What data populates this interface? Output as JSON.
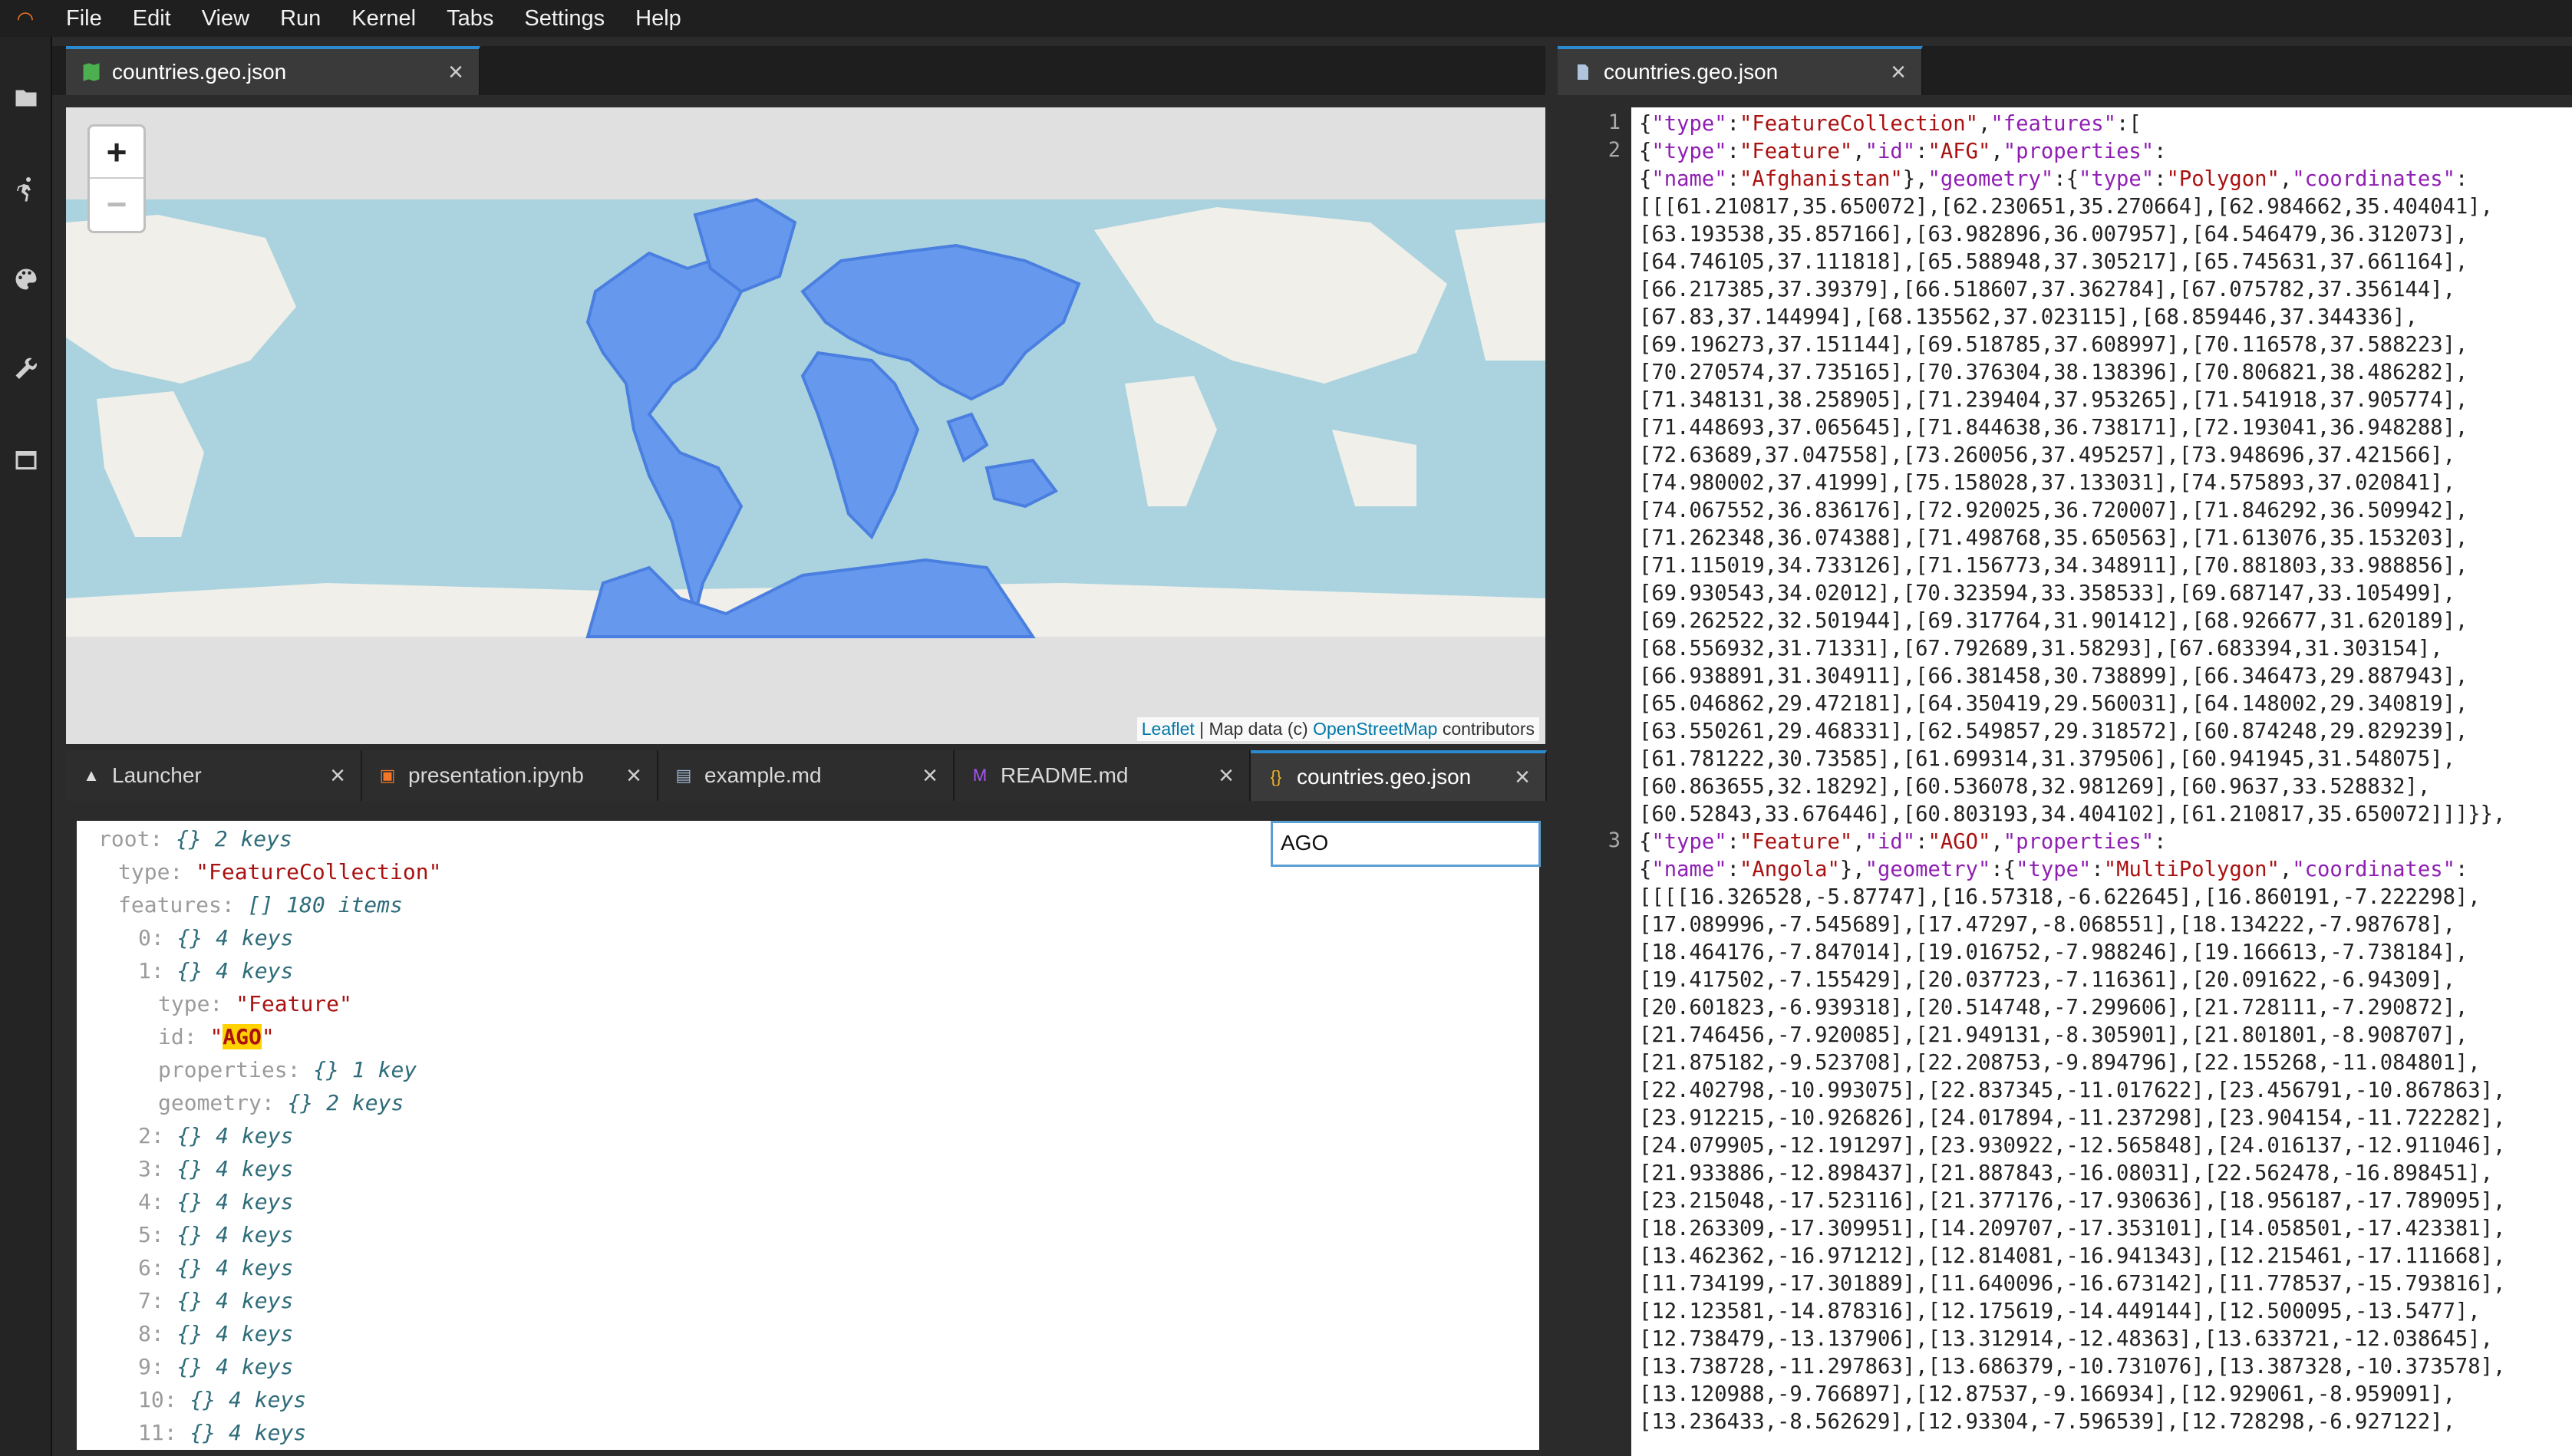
{
  "menubar": {
    "items": [
      "File",
      "Edit",
      "View",
      "Run",
      "Kernel",
      "Tabs",
      "Settings",
      "Help"
    ]
  },
  "sidebar": {
    "icons": [
      "folder-icon",
      "running-icon",
      "palette-icon",
      "wrench-icon",
      "tabs-icon"
    ]
  },
  "left_panel": {
    "tab": {
      "label": "countries.geo.json",
      "icon": "map-icon"
    }
  },
  "map": {
    "zoom_in": "+",
    "zoom_out": "−",
    "attribution": {
      "leaflet": "Leaflet",
      "sep": " | Map data (c) ",
      "osm": "OpenStreetMap",
      "tail": " contributors"
    }
  },
  "bottom_tabs": [
    {
      "label": "Launcher",
      "icon": "launcher-icon"
    },
    {
      "label": "presentation.ipynb",
      "icon": "notebook-icon"
    },
    {
      "label": "example.md",
      "icon": "file-icon"
    },
    {
      "label": "README.md",
      "icon": "markdown-icon"
    },
    {
      "label": "countries.geo.json",
      "icon": "json-icon",
      "active": true
    }
  ],
  "json_tree": {
    "search_value": "AGO",
    "rows": [
      {
        "indent": 0,
        "key": "root:",
        "val": "{}",
        "meta": "2 keys"
      },
      {
        "indent": 1,
        "key": "type:",
        "str": "\"FeatureCollection\""
      },
      {
        "indent": 1,
        "key": "features:",
        "val": "[]",
        "meta": "180 items"
      },
      {
        "indent": 2,
        "key": "0:",
        "val": "{}",
        "meta": "4 keys"
      },
      {
        "indent": 2,
        "key": "1:",
        "val": "{}",
        "meta": "4 keys"
      },
      {
        "indent": 3,
        "key": "type:",
        "str": "\"Feature\""
      },
      {
        "indent": 3,
        "key": "id:",
        "str_hl": [
          "\"",
          "AGO",
          "\""
        ]
      },
      {
        "indent": 3,
        "key": "properties:",
        "val": "{}",
        "meta": "1 key"
      },
      {
        "indent": 3,
        "key": "geometry:",
        "val": "{}",
        "meta": "2 keys"
      },
      {
        "indent": 2,
        "key": "2:",
        "val": "{}",
        "meta": "4 keys"
      },
      {
        "indent": 2,
        "key": "3:",
        "val": "{}",
        "meta": "4 keys"
      },
      {
        "indent": 2,
        "key": "4:",
        "val": "{}",
        "meta": "4 keys"
      },
      {
        "indent": 2,
        "key": "5:",
        "val": "{}",
        "meta": "4 keys"
      },
      {
        "indent": 2,
        "key": "6:",
        "val": "{}",
        "meta": "4 keys"
      },
      {
        "indent": 2,
        "key": "7:",
        "val": "{}",
        "meta": "4 keys"
      },
      {
        "indent": 2,
        "key": "8:",
        "val": "{}",
        "meta": "4 keys"
      },
      {
        "indent": 2,
        "key": "9:",
        "val": "{}",
        "meta": "4 keys"
      },
      {
        "indent": 2,
        "key": "10:",
        "val": "{}",
        "meta": "4 keys"
      },
      {
        "indent": 2,
        "key": "11:",
        "val": "{}",
        "meta": "4 keys"
      }
    ]
  },
  "right_panel": {
    "tab": {
      "label": "countries.geo.json",
      "icon": "file-icon"
    },
    "line_numbers": [
      {
        "n": "1",
        "line_index": 0
      },
      {
        "n": "2",
        "line_index": 1
      },
      {
        "n": "3",
        "line_index": 26
      }
    ],
    "code_lines": [
      "{\"type\":\"FeatureCollection\",\"features\":[",
      "{\"type\":\"Feature\",\"id\":\"AFG\",\"properties\":",
      "{\"name\":\"Afghanistan\"},\"geometry\":{\"type\":\"Polygon\",\"coordinates\":",
      "[[[61.210817,35.650072],[62.230651,35.270664],[62.984662,35.404041],",
      "[63.193538,35.857166],[63.982896,36.007957],[64.546479,36.312073],",
      "[64.746105,37.111818],[65.588948,37.305217],[65.745631,37.661164],",
      "[66.217385,37.39379],[66.518607,37.362784],[67.075782,37.356144],",
      "[67.83,37.144994],[68.135562,37.023115],[68.859446,37.344336],",
      "[69.196273,37.151144],[69.518785,37.608997],[70.116578,37.588223],",
      "[70.270574,37.735165],[70.376304,38.138396],[70.806821,38.486282],",
      "[71.348131,38.258905],[71.239404,37.953265],[71.541918,37.905774],",
      "[71.448693,37.065645],[71.844638,36.738171],[72.193041,36.948288],",
      "[72.63689,37.047558],[73.260056,37.495257],[73.948696,37.421566],",
      "[74.980002,37.41999],[75.158028,37.133031],[74.575893,37.020841],",
      "[74.067552,36.836176],[72.920025,36.720007],[71.846292,36.509942],",
      "[71.262348,36.074388],[71.498768,35.650563],[71.613076,35.153203],",
      "[71.115019,34.733126],[71.156773,34.348911],[70.881803,33.988856],",
      "[69.930543,34.02012],[70.323594,33.358533],[69.687147,33.105499],",
      "[69.262522,32.501944],[69.317764,31.901412],[68.926677,31.620189],",
      "[68.556932,31.71331],[67.792689,31.58293],[67.683394,31.303154],",
      "[66.938891,31.304911],[66.381458,30.738899],[66.346473,29.887943],",
      "[65.046862,29.472181],[64.350419,29.560031],[64.148002,29.340819],",
      "[63.550261,29.468331],[62.549857,29.318572],[60.874248,29.829239],",
      "[61.781222,30.73585],[61.699314,31.379506],[60.941945,31.548075],",
      "[60.863655,32.18292],[60.536078,32.981269],[60.9637,33.528832],",
      "[60.52843,33.676446],[60.803193,34.404102],[61.210817,35.650072]]]}},",
      "{\"type\":\"Feature\",\"id\":\"AGO\",\"properties\":",
      "{\"name\":\"Angola\"},\"geometry\":{\"type\":\"MultiPolygon\",\"coordinates\":",
      "[[[[16.326528,-5.87747],[16.57318,-6.622645],[16.860191,-7.222298],",
      "[17.089996,-7.545689],[17.47297,-8.068551],[18.134222,-7.987678],",
      "[18.464176,-7.847014],[19.016752,-7.988246],[19.166613,-7.738184],",
      "[19.417502,-7.155429],[20.037723,-7.116361],[20.091622,-6.94309],",
      "[20.601823,-6.939318],[20.514748,-7.299606],[21.728111,-7.290872],",
      "[21.746456,-7.920085],[21.949131,-8.305901],[21.801801,-8.908707],",
      "[21.875182,-9.523708],[22.208753,-9.894796],[22.155268,-11.084801],",
      "[22.402798,-10.993075],[22.837345,-11.017622],[23.456791,-10.867863],",
      "[23.912215,-10.926826],[24.017894,-11.237298],[23.904154,-11.722282],",
      "[24.079905,-12.191297],[23.930922,-12.565848],[24.016137,-12.911046],",
      "[21.933886,-12.898437],[21.887843,-16.08031],[22.562478,-16.898451],",
      "[23.215048,-17.523116],[21.377176,-17.930636],[18.956187,-17.789095],",
      "[18.263309,-17.309951],[14.209707,-17.353101],[14.058501,-17.423381],",
      "[13.462362,-16.971212],[12.814081,-16.941343],[12.215461,-17.111668],",
      "[11.734199,-17.301889],[11.640096,-16.673142],[11.778537,-15.793816],",
      "[12.123581,-14.878316],[12.175619,-14.449144],[12.500095,-13.5477],",
      "[12.738479,-13.137906],[13.312914,-12.48363],[13.633721,-12.038645],",
      "[13.738728,-11.297863],[13.686379,-10.731076],[13.387328,-10.373578],",
      "[13.120988,-9.766897],[12.87537,-9.166934],[12.929061,-8.959091],",
      "[13.236433,-8.562629],[12.93304,-7.596539],[12.728298,-6.927122],"
    ]
  }
}
